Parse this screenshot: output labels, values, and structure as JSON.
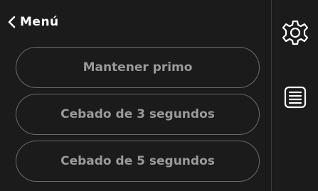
{
  "header": {
    "back_label": "Menú"
  },
  "options": [
    {
      "label": "Mantener primo"
    },
    {
      "label": "Cebado de 3 segundos"
    },
    {
      "label": "Cebado de 5 segundos"
    }
  ],
  "sidebar": {
    "settings_icon": "gear-icon",
    "list_icon": "list-icon"
  },
  "colors": {
    "background": "#1b1b1b",
    "option_border": "#6b6b6b",
    "option_text": "#9a9a9a",
    "header_text": "#ffffff",
    "icon": "#ffffff"
  }
}
